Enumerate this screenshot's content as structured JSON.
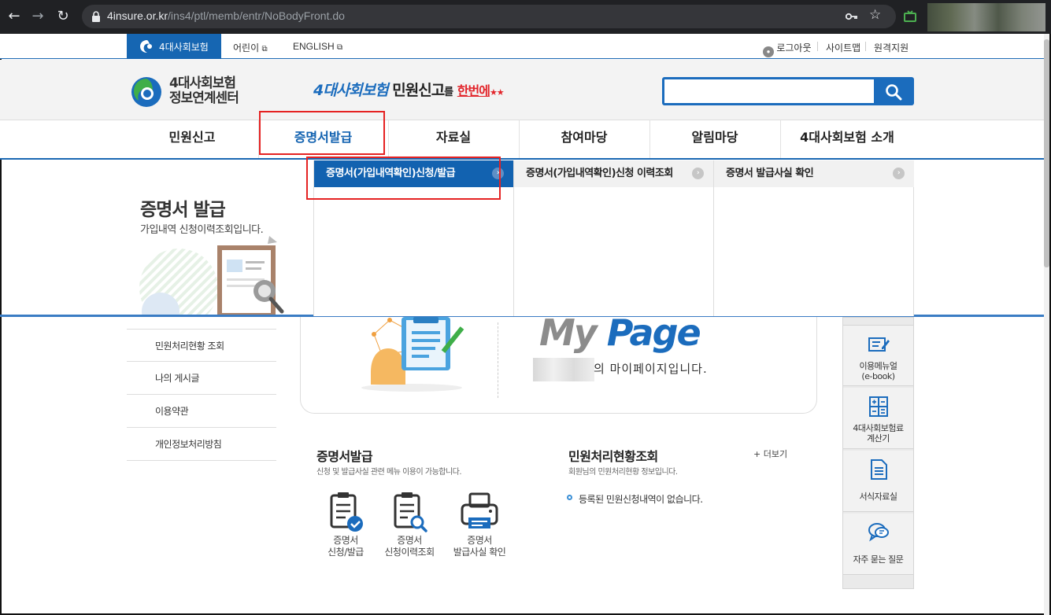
{
  "browser": {
    "url_host": "4insure.or.kr",
    "url_path": "/ins4/ptl/memb/entr/NoBodyFront.do"
  },
  "utility": {
    "home_label": "4대사회보험",
    "kids_label": "어린이",
    "english_label": "ENGLISH",
    "logout_label": "로그아웃",
    "sitemap_label": "사이트맵",
    "remote_label": "원격지원"
  },
  "header": {
    "logo_line1": "4대사회보험",
    "logo_line2": "정보연계센터",
    "slogan_part1": "4대사회보험",
    "slogan_part2": "민원신고",
    "slogan_part3": "를",
    "slogan_part4": "한번에",
    "search_placeholder": ""
  },
  "gnb": {
    "items": [
      {
        "label": "민원신고"
      },
      {
        "label": "증명서발급"
      },
      {
        "label": "자료실"
      },
      {
        "label": "참여마당"
      },
      {
        "label": "알림마당"
      },
      {
        "label": "4대사회보험 소개"
      }
    ]
  },
  "mega": {
    "items": [
      {
        "label": "증명서(가입내역확인)신청/발급"
      },
      {
        "label": "증명서(가입내역확인)신청 이력조회"
      },
      {
        "label": "증명서 발급사실 확인"
      }
    ]
  },
  "lnb": {
    "title": "증명서 발급",
    "subtitle": "가입내역 신청이력조회입니다.",
    "links": [
      {
        "label": "민원처리현황 조회"
      },
      {
        "label": "나의 게시글"
      },
      {
        "label": "이용약관"
      },
      {
        "label": "개인정보처리방침"
      }
    ]
  },
  "mypage": {
    "title_my": "My",
    "title_page": "Page",
    "desc": "의 마이페이지입니다."
  },
  "cert_section": {
    "title": "증명서발급",
    "subtitle": "신청 및 발급사실 관련 메뉴 이용이 가능합니다.",
    "items": [
      {
        "line1": "증명서",
        "line2": "신청/발급"
      },
      {
        "line1": "증명서",
        "line2": "신청이력조회"
      },
      {
        "line1": "증명서",
        "line2": "발급사실 확인"
      }
    ]
  },
  "status_section": {
    "title": "민원처리현황조회",
    "subtitle": "회원님의 민원처리현황 정보입니다.",
    "more": "+ 더보기",
    "empty_text": "등록된 민원신청내역이 없습니다."
  },
  "quickbar": {
    "items": [
      {
        "line1": "이용메뉴얼",
        "line2": "(e-book)"
      },
      {
        "line1": "4대사회보험료",
        "line2": "계산기"
      },
      {
        "line1": "서식자료실",
        "line2": ""
      },
      {
        "line1": "자주 묻는 질문",
        "line2": ""
      }
    ]
  },
  "colors": {
    "brand_blue": "#1666b2",
    "highlight_red": "#e52222",
    "slogan_red": "#e2242a"
  }
}
